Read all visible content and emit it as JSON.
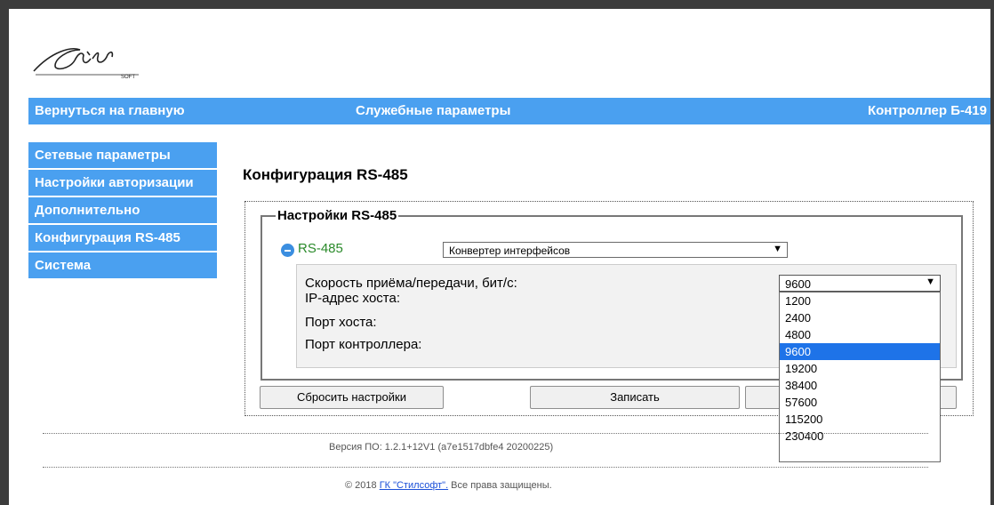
{
  "logo": {
    "text": "SOFT"
  },
  "topbar": {
    "home": "Вернуться на главную",
    "service": "Служебные параметры",
    "device": "Контроллер Б-419"
  },
  "sidebar": {
    "items": [
      {
        "label": "Сетевые параметры"
      },
      {
        "label": "Настройки авторизации"
      },
      {
        "label": "Дополнительно"
      },
      {
        "label": "Конфигурация RS-485"
      },
      {
        "label": "Система"
      }
    ]
  },
  "main": {
    "heading": "Конфигурация RS-485",
    "legend": "Настройки RS-485",
    "rs_label": "RS-485",
    "mode_value": "Конвертер интерфейсов",
    "params": {
      "speed": "Скорость приёма/передачи, бит/с:",
      "host_ip": "IP-адрес хоста:",
      "host_port": "Порт хоста:",
      "ctrl_port": "Порт контроллера:"
    },
    "speed_value": "9600",
    "speed_options": [
      "1200",
      "2400",
      "4800",
      "9600",
      "19200",
      "38400",
      "57600",
      "115200",
      "230400"
    ],
    "buttons": {
      "reset": "Сбросить настройки",
      "write": "Записать"
    }
  },
  "footer": {
    "version": "Версия ПО: 1.2.1+12V1 (a7e1517dbfe4 20200225)",
    "copy_prefix": "© 2018 ",
    "copy_link": "ГК \"Стилсофт\".",
    "copy_suffix": " Все права защищены."
  },
  "colors": {
    "accent": "#4aa0f0",
    "selected_option": "#1e73e8",
    "rs_label": "#2a8a2a"
  }
}
